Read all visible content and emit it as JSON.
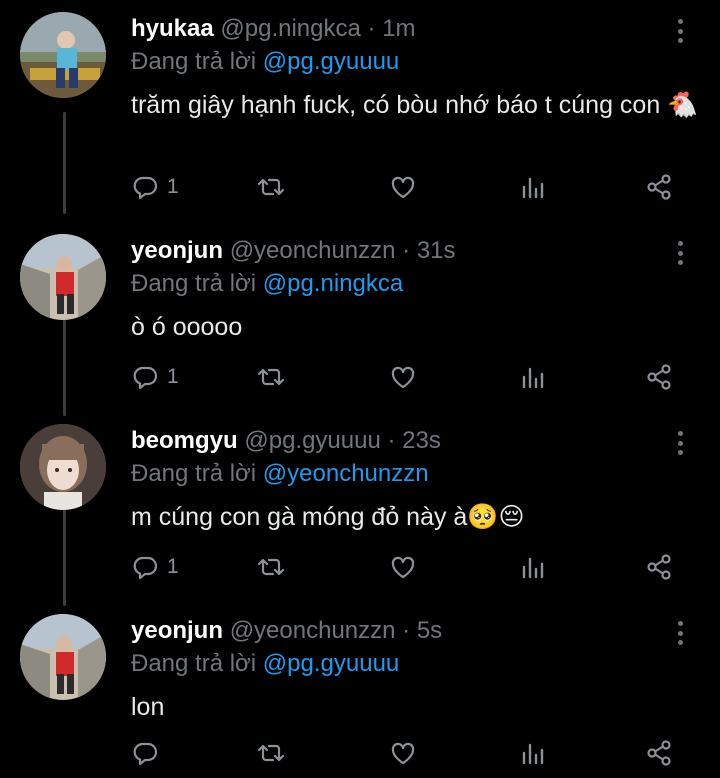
{
  "colors": {
    "background": "#000000",
    "primary_text": "#e7e9ea",
    "secondary_text": "#71767b",
    "mention": "#1d9bf0",
    "thread_line": "#3a3d41"
  },
  "tweets": [
    {
      "name": "hyukaa",
      "handle": "@pg.ningkca",
      "separator": "·",
      "time": "1m",
      "reply_prefix": "Đang trả lời",
      "reply_to": "@pg.gyuuuu",
      "text": "trăm giây hạnh fuck, có bòu nhớ báo t cúng con 🐔",
      "reply_count": "1",
      "avatar_icon": "profile-photo"
    },
    {
      "name": "yeonjun",
      "handle": "@yeonchunzzn",
      "separator": "·",
      "time": "31s",
      "reply_prefix": "Đang trả lời",
      "reply_to": "@pg.ningkca",
      "text": "ò ó ooooo",
      "reply_count": "1",
      "avatar_icon": "profile-photo"
    },
    {
      "name": "beomgyu",
      "handle": "@pg.gyuuuu",
      "separator": "·",
      "time": "23s",
      "reply_prefix": "Đang trả lời",
      "reply_to": "@yeonchunzzn",
      "text": "m cúng con gà móng đỏ này à🥺😔",
      "reply_count": "1",
      "avatar_icon": "profile-photo"
    },
    {
      "name": "yeonjun",
      "handle": "@yeonchunzzn",
      "separator": "·",
      "time": "5s",
      "reply_prefix": "Đang trả lời",
      "reply_to": "@pg.gyuuuu",
      "text": "lon",
      "reply_count": "",
      "avatar_icon": "profile-photo"
    }
  ],
  "action_icons": [
    "reply-icon",
    "retweet-icon",
    "like-icon",
    "views-icon",
    "share-icon"
  ]
}
